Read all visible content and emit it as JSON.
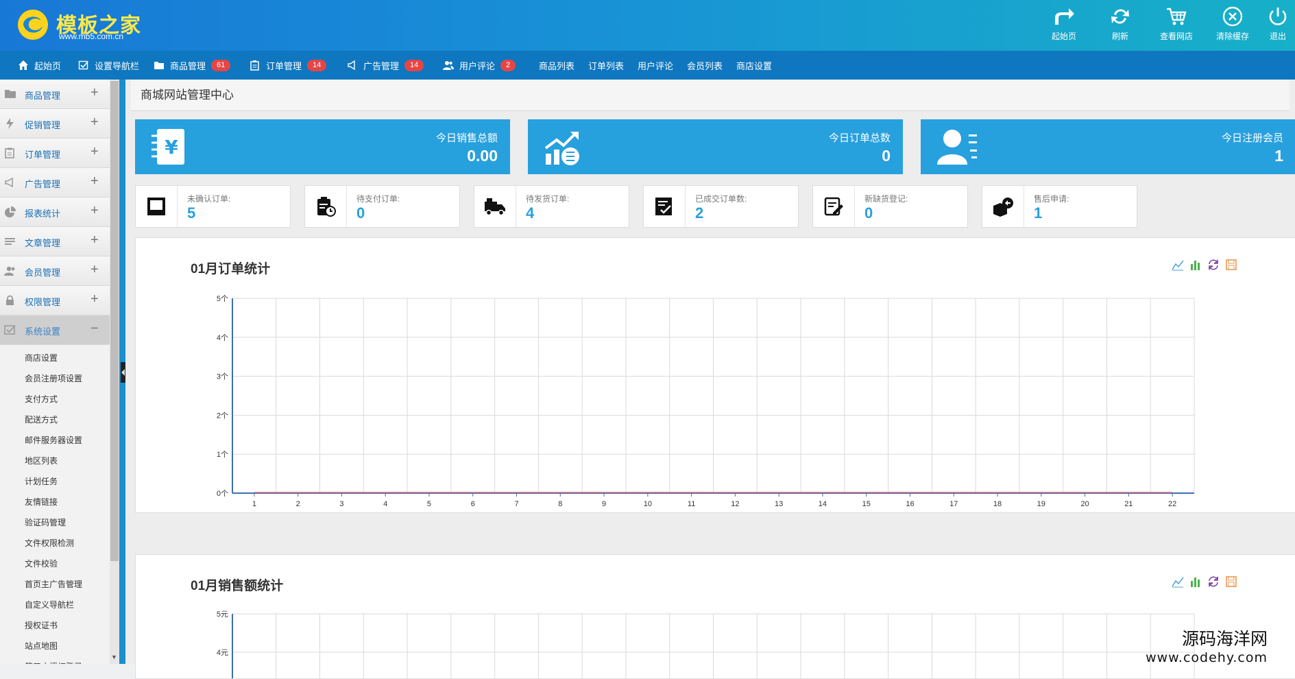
{
  "logo": {
    "title": "模板之家",
    "url": "www.mb5.com.cn"
  },
  "top_actions": [
    {
      "label": "起始页",
      "icon": "share-arrow-icon"
    },
    {
      "label": "刷新",
      "icon": "refresh-icon"
    },
    {
      "label": "查看网店",
      "icon": "cart-icon"
    },
    {
      "label": "清除缓存",
      "icon": "close-circle-icon"
    },
    {
      "label": "退出",
      "icon": "power-icon"
    }
  ],
  "nav": [
    {
      "label": "起始页",
      "icon": "home-icon",
      "badge": ""
    },
    {
      "label": "设置导航栏",
      "icon": "checkbox-icon",
      "badge": ""
    },
    {
      "label": "商品管理",
      "icon": "folder-icon",
      "badge": "61"
    },
    {
      "label": "订单管理",
      "icon": "clipboard-icon",
      "badge": "14"
    },
    {
      "label": "广告管理",
      "icon": "megaphone-icon",
      "badge": "14"
    },
    {
      "label": "用户评论",
      "icon": "users-icon",
      "badge": "2"
    },
    {
      "label": "商品列表",
      "icon": "",
      "badge": ""
    },
    {
      "label": "订单列表",
      "icon": "",
      "badge": ""
    },
    {
      "label": "用户评论",
      "icon": "",
      "badge": ""
    },
    {
      "label": "会员列表",
      "icon": "",
      "badge": ""
    },
    {
      "label": "商店设置",
      "icon": "",
      "badge": ""
    }
  ],
  "sidebar": {
    "groups": [
      {
        "label": "商品管理",
        "icon": "folder-icon",
        "toggle": "+"
      },
      {
        "label": "促销管理",
        "icon": "bolt-icon",
        "toggle": "+"
      },
      {
        "label": "订单管理",
        "icon": "clipboard-icon",
        "toggle": "+"
      },
      {
        "label": "广告管理",
        "icon": "megaphone-icon",
        "toggle": "+"
      },
      {
        "label": "报表统计",
        "icon": "pie-icon",
        "toggle": "+"
      },
      {
        "label": "文章管理",
        "icon": "lines-icon",
        "toggle": "+"
      },
      {
        "label": "会员管理",
        "icon": "users-icon",
        "toggle": "+"
      },
      {
        "label": "权限管理",
        "icon": "lock-icon",
        "toggle": "+"
      },
      {
        "label": "系统设置",
        "icon": "checkbox-icon",
        "toggle": "−"
      }
    ],
    "sub_items": [
      "商店设置",
      "会员注册项设置",
      "支付方式",
      "配送方式",
      "邮件服务器设置",
      "地区列表",
      "计划任务",
      "友情链接",
      "验证码管理",
      "文件权限检测",
      "文件校验",
      "首页主广告管理",
      "自定义导航栏",
      "授权证书",
      "站点地图",
      "第三方授权登录"
    ]
  },
  "page_title": "商城网站管理中心",
  "stats": [
    {
      "label": "今日销售总额",
      "value": "0.00",
      "icon": "yen-notebook-icon"
    },
    {
      "label": "今日订单总数",
      "value": "0",
      "icon": "growth-chart-icon"
    },
    {
      "label": "今日注册会员",
      "value": "1",
      "icon": "user-list-icon"
    }
  ],
  "mini_stats": [
    {
      "label": "未确认订单:",
      "value": "5",
      "icon": "square-icon"
    },
    {
      "label": "待支付订单:",
      "value": "0",
      "icon": "clipboard-clock-icon"
    },
    {
      "label": "待发货订单:",
      "value": "4",
      "icon": "truck-icon"
    },
    {
      "label": "已成交订单数:",
      "value": "2",
      "icon": "check-doc-icon"
    },
    {
      "label": "新缺货登记:",
      "value": "0",
      "icon": "edit-doc-icon"
    },
    {
      "label": "售后申请:",
      "value": "1",
      "icon": "return-box-icon"
    }
  ],
  "chart_tools": [
    "line-chart-icon",
    "bar-chart-icon",
    "refresh-icon",
    "save-icon"
  ],
  "chart_data": [
    {
      "type": "line",
      "title": "01月订单统计",
      "x": [
        "1",
        "2",
        "3",
        "4",
        "5",
        "6",
        "7",
        "8",
        "9",
        "10",
        "11",
        "12",
        "13",
        "14",
        "15",
        "16",
        "17",
        "18",
        "19",
        "20",
        "21",
        "22"
      ],
      "series": [
        {
          "values": [
            0,
            0,
            0,
            0,
            0,
            0,
            0,
            0,
            0,
            0,
            0,
            0,
            0,
            0,
            0,
            0,
            0,
            0,
            0,
            0,
            0,
            0
          ]
        }
      ],
      "yticks": [
        "0个",
        "1个",
        "2个",
        "3个",
        "4个",
        "5个"
      ],
      "ylim": [
        0,
        5
      ],
      "grid": true,
      "colors": {
        "line": "#e86b6b",
        "axis": "#3c6fb5",
        "grid": "#d9d9d9"
      }
    },
    {
      "type": "line",
      "title": "01月销售额统计",
      "yticks": [
        "4元",
        "5元"
      ],
      "ylim": [
        0,
        5
      ],
      "grid": true,
      "colors": {
        "axis": "#3c6fb5",
        "grid": "#d9d9d9"
      }
    }
  ],
  "watermark": {
    "line1": "源码海洋网",
    "line2": "www.codehy.com"
  }
}
